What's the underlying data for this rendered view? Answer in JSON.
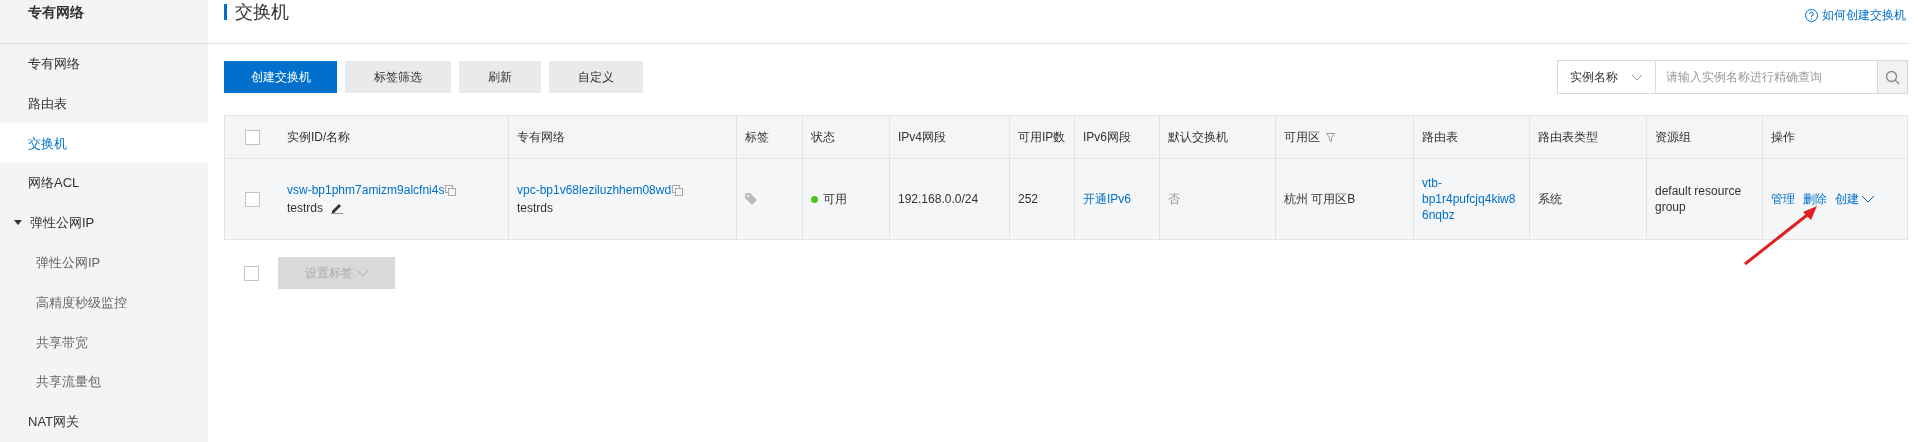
{
  "sidebar": {
    "title": "专有网络",
    "items": [
      {
        "label": "专有网络",
        "selected": false
      },
      {
        "label": "路由表",
        "selected": false
      },
      {
        "label": "交换机",
        "selected": true
      },
      {
        "label": "网络ACL",
        "selected": false
      },
      {
        "label": "弹性公网IP",
        "selected": false,
        "expanded": true,
        "children": [
          {
            "label": "弹性公网IP",
            "selected": false
          },
          {
            "label": "高精度秒级监控",
            "selected": false
          },
          {
            "label": "共享带宽",
            "selected": false
          },
          {
            "label": "共享流量包",
            "selected": false
          }
        ]
      },
      {
        "label": "NAT网关",
        "selected": false
      }
    ]
  },
  "page": {
    "title": "交换机",
    "help_link": "如何创建交换机"
  },
  "toolbar": {
    "buttons": [
      {
        "label": "创建交换机",
        "kind": "primary"
      },
      {
        "label": "标签筛选",
        "kind": "default"
      },
      {
        "label": "刷新",
        "kind": "default"
      },
      {
        "label": "自定义",
        "kind": "default"
      }
    ],
    "search": {
      "select": "实例名称",
      "placeholder": "请输入实例名称进行精确查询"
    }
  },
  "table": {
    "header_checked": false,
    "columns": [
      {
        "label": "实例ID/名称"
      },
      {
        "label": "专有网络"
      },
      {
        "label": "标签"
      },
      {
        "label": "状态"
      },
      {
        "label": "IPv4网段"
      },
      {
        "label": "可用IP数"
      },
      {
        "label": "IPv6网段"
      },
      {
        "label": "默认交换机"
      },
      {
        "label": "可用区",
        "filter": true
      },
      {
        "label": "路由表"
      },
      {
        "label": "路由表类型"
      },
      {
        "label": "资源组"
      },
      {
        "label": "操作"
      }
    ],
    "rows": [
      {
        "checked": false,
        "id": "vsw-bp1phm7amizm9alcfni4s",
        "name": "testrds",
        "vpc_id": "vpc-bp1v68leziluzhhem08wd",
        "vpc_name": "testrds",
        "status": "可用",
        "color": "#52c41a",
        "ipv4": "192.168.0.0/24",
        "ip_count": "252",
        "ipv6": "开通IPv6",
        "default_switch": "否",
        "zone": "杭州 可用区B",
        "route_table": "vtb-bp1r4pufcjq4kiw86nqbz",
        "route_table_type": "系统",
        "resource_group": "default resource group",
        "actions": [
          "管理",
          "删除",
          "创建"
        ]
      }
    ]
  },
  "footer": {
    "checked": false,
    "button": {
      "label": "设置标签",
      "disabled": true
    }
  }
}
